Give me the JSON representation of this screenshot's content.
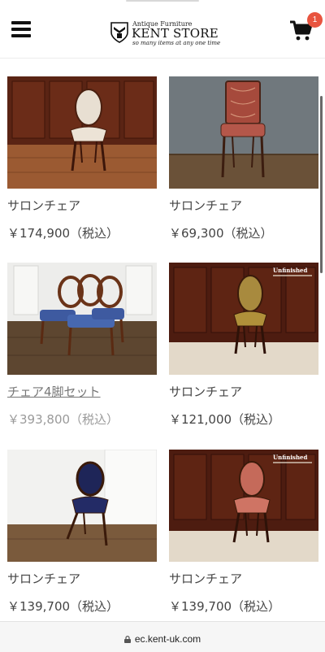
{
  "header": {
    "logo_small": "Antique Furniture",
    "logo_main": "KENT STORE",
    "logo_tagline": "so many items at any one time",
    "cart_count": "1"
  },
  "products": [
    {
      "name": "サロンチェア",
      "price": "￥174,900（税込）"
    },
    {
      "name": "サロンチェア",
      "price": "￥69,300（税込）"
    },
    {
      "name": "チェア4脚セット",
      "price": "￥393,800（税込）"
    },
    {
      "name": "サロンチェア",
      "price": "￥121,000（税込）"
    },
    {
      "name": "サロンチェア",
      "price": "￥139,700（税込）"
    },
    {
      "name": "サロンチェア",
      "price": "￥139,700（税込）"
    }
  ],
  "photo_labels": {
    "unfinished": "Unfinished"
  },
  "browser": {
    "url": "ec.kent-uk.com"
  },
  "colors": {
    "accent_badge": "#e8543f",
    "muted_price": "#9a9a9a"
  }
}
